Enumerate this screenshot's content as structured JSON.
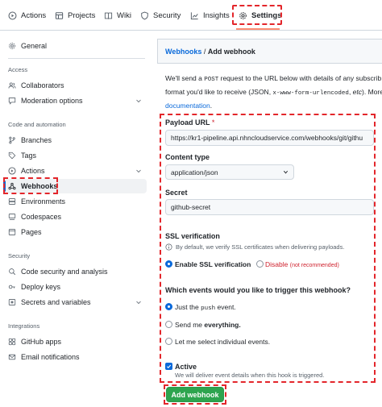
{
  "topnav": {
    "tabs": [
      {
        "label": "Actions",
        "icon": "play-icon"
      },
      {
        "label": "Projects",
        "icon": "table-icon"
      },
      {
        "label": "Wiki",
        "icon": "book-icon"
      },
      {
        "label": "Security",
        "icon": "shield-icon"
      },
      {
        "label": "Insights",
        "icon": "graph-icon"
      },
      {
        "label": "Settings",
        "icon": "gear-icon",
        "active": true
      }
    ]
  },
  "sidebar": {
    "general": "General",
    "access_heading": "Access",
    "collaborators": "Collaborators",
    "moderation": "Moderation options",
    "code_heading": "Code and automation",
    "branches": "Branches",
    "tags": "Tags",
    "actions": "Actions",
    "webhooks": "Webhooks",
    "environments": "Environments",
    "codespaces": "Codespaces",
    "pages": "Pages",
    "security_heading": "Security",
    "code_security": "Code security and analysis",
    "deploy_keys": "Deploy keys",
    "secrets": "Secrets and variables",
    "integrations_heading": "Integrations",
    "github_apps": "GitHub apps",
    "email_notifications": "Email notifications",
    "active_item": "Webhooks"
  },
  "main": {
    "breadcrumb_link": "Webhooks",
    "breadcrumb_sep": " / ",
    "breadcrumb_current": "Add webhook",
    "desc_line1_a": "We'll send a ",
    "desc_line1_code": "POST",
    "desc_line1_b": " request to the URL below with details of any subscrib",
    "desc_line2_a": "format you'd like to receive (JSON, ",
    "desc_line2_code": "x-www-form-urlencoded",
    "desc_line2_b": ", ",
    "desc_line2_etc": "etc",
    "desc_line2_c": "). More",
    "desc_line3_link": "documentation",
    "desc_line3_end": "."
  },
  "form": {
    "payload_label": "Payload URL",
    "payload_required": "*",
    "payload_value": "https://kr1-pipeline.api.nhncloudservice.com/webhooks/git/githu",
    "content_type_label": "Content type",
    "content_type_value": "application/json",
    "secret_label": "Secret",
    "secret_value": "github-secret",
    "ssl_label": "SSL verification",
    "ssl_note": "By default, we verify SSL certificates when delivering payloads.",
    "ssl_enable": "Enable SSL verification",
    "ssl_disable": "Disable",
    "ssl_disable_note": "(not recommended)",
    "events_label": "Which events would you like to trigger this webhook?",
    "event_push_a": "Just the ",
    "event_push_code": "push",
    "event_push_b": " event.",
    "event_everything_a": "Send me ",
    "event_everything_b": "everything.",
    "event_individual": "Let me select individual events.",
    "selected_event": "push",
    "active_label": "Active",
    "active_checked": true,
    "active_note": "We will deliver event details when this hook is triggered.",
    "submit": "Add webhook"
  },
  "colors": {
    "highlight": "#e3262b",
    "link": "#0969da",
    "primary_button": "#2da44e",
    "tab_underline": "#fd8c73",
    "danger": "#cf222e"
  }
}
